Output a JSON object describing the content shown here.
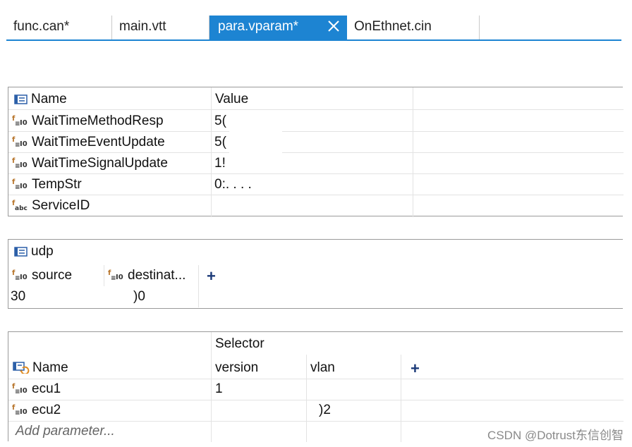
{
  "tabs": [
    {
      "label": "func.can*"
    },
    {
      "label": "main.vtt"
    },
    {
      "label": "para.vparam*",
      "active": true
    },
    {
      "label": "OnEthnet.cin"
    }
  ],
  "params_table": {
    "header": {
      "name": "Name",
      "value": "Value"
    },
    "rows": [
      {
        "name": "WaitTimeMethodResp",
        "value": "5(",
        "icon": "int-param-icon"
      },
      {
        "name": "WaitTimeEventUpdate",
        "value": "5(",
        "icon": "int-param-icon"
      },
      {
        "name": "WaitTimeSignalUpdate",
        "value": "1!",
        "icon": "int-param-icon"
      },
      {
        "name": "TempStr",
        "value": "0:. . . .",
        "icon": "int-param-icon"
      },
      {
        "name": "ServiceID",
        "value": "",
        "icon": "string-param-icon"
      }
    ]
  },
  "udp_table": {
    "title": "udp",
    "columns": [
      "source",
      "destinat..."
    ],
    "add_symbol": "+",
    "values": [
      "30",
      ")0"
    ]
  },
  "ecu_table": {
    "group_header": "Selector",
    "columns": {
      "name": "Name",
      "version": "version",
      "vlan": "vlan"
    },
    "add_symbol": "+",
    "rows": [
      {
        "name": "ecu1",
        "version": "1",
        "vlan": ""
      },
      {
        "name": "ecu2",
        "version": "",
        "vlan": ")2"
      }
    ],
    "add_placeholder": "Add parameter..."
  },
  "watermark": "CSDN @Dotrust东信创智",
  "colors": {
    "accent": "#1d84d2",
    "border": "#9a9a9a",
    "gridline": "#e3e3e3"
  }
}
